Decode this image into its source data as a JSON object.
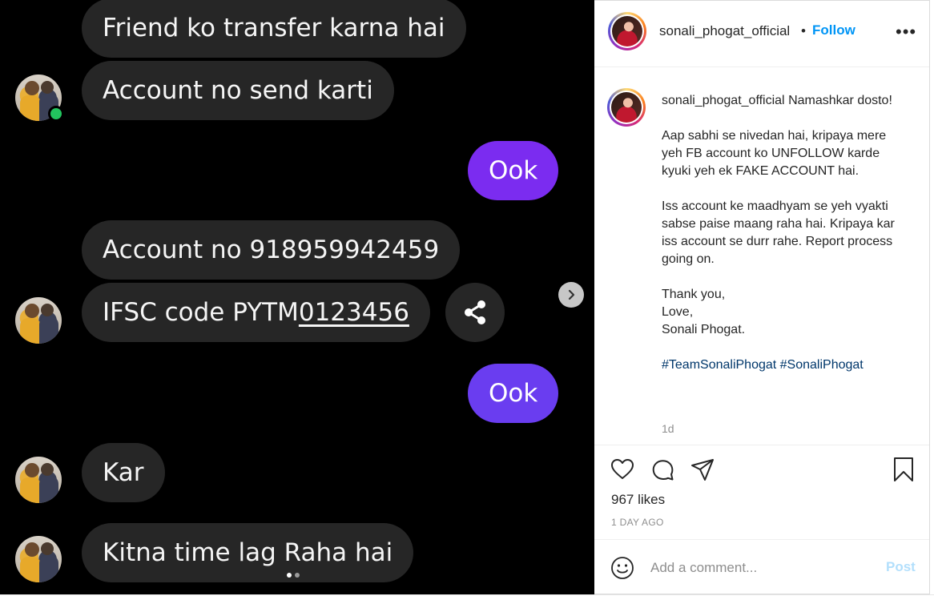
{
  "chat": {
    "messages": [
      {
        "dir": "in",
        "text": "Friend ko transfer karna hai"
      },
      {
        "dir": "in",
        "text": "Account no send karti"
      },
      {
        "dir": "out",
        "text": "Ook"
      },
      {
        "dir": "in",
        "text": "Account no 918959942459"
      },
      {
        "dir": "in",
        "text_prefix": "IFSC code PYTM",
        "text_link": "0123456"
      },
      {
        "dir": "out",
        "text": "Ook"
      },
      {
        "dir": "in",
        "text": "Kar"
      },
      {
        "dir": "in",
        "text": "Kitna time lag Raha hai"
      }
    ],
    "carousel": {
      "count": 2,
      "active_index": 0
    }
  },
  "post": {
    "header": {
      "username": "sonali_phogat_official",
      "separator": "•",
      "follow_label": "Follow",
      "more_label": "•••"
    },
    "caption": {
      "username": "sonali_phogat_official",
      "text": "Namashkar dosto!\n\nAap sabhi se nivedan hai, kripaya mere yeh FB account ko UNFOLLOW karde kyuki yeh ek FAKE ACCOUNT hai.\n\nIss account ke maadhyam se yeh vyakti sabse paise maang raha hai. Kripaya kar iss account se durr rahe. Report process going on.\n\nThank you,\nLove,\nSonali Phogat.\n\n",
      "hashtags": "#TeamSonaliPhogat #SonaliPhogat",
      "time": "1d"
    },
    "likes": "967 likes",
    "posted_ago": "1 DAY AGO",
    "comment": {
      "placeholder": "Add a comment...",
      "post_label": "Post"
    },
    "colors": {
      "follow": "#0095f6",
      "hashtag": "#00376b",
      "post_disabled": "#b2dffc",
      "outgoing_bubble_1": "#7b2cf0",
      "outgoing_bubble_2": "#6a3df0"
    }
  }
}
